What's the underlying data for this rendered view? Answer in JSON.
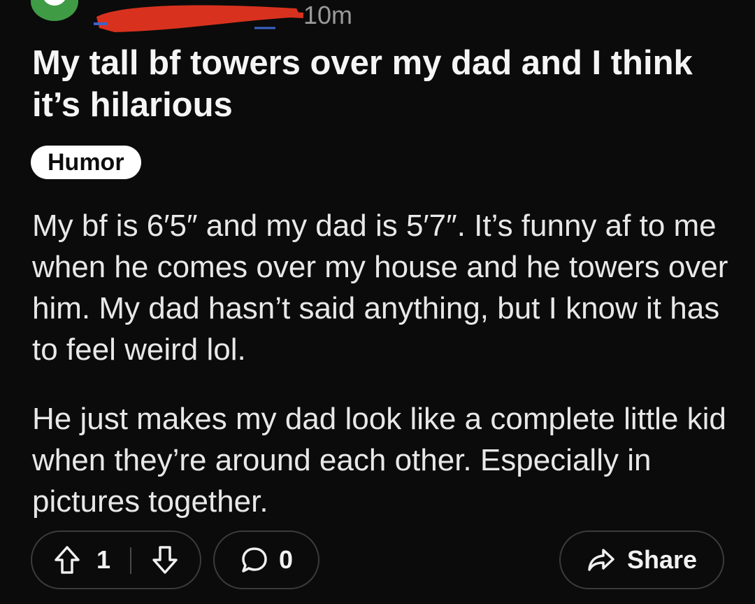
{
  "post": {
    "timestamp": "10m",
    "title": "My tall bf towers over my dad and I think it’s hilarious",
    "flair": "Humor",
    "body": [
      "My bf is 6′5″ and my dad is 5′7″. It’s funny af to me when he comes over my house and he towers over him. My dad hasn’t said anything, but I know it has to feel weird lol.",
      "He just makes my dad look like a complete little kid when they’re around each other. Especially in pictures together."
    ]
  },
  "actions": {
    "score": "1",
    "comment_count": "0",
    "share_label": "Share"
  },
  "colors": {
    "background": "#0b0b0b",
    "avatar": "#3f9c45",
    "redaction": "#d8321f",
    "flair_bg": "#ffffff",
    "pill_border": "#3b3b3b"
  },
  "icons": [
    "avatar-icon",
    "upvote-icon",
    "downvote-icon",
    "comment-icon",
    "share-icon"
  ]
}
